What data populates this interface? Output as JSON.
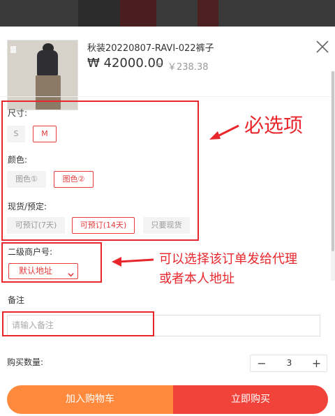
{
  "product": {
    "title": "秋装20220807-RAVI-022裤子",
    "price": "₩ 42000.00",
    "approx_symbol": "≈",
    "price_rmb": "￥238.38"
  },
  "icons": {
    "close": "close-icon",
    "caret": "chevron-down-icon",
    "arrow": "arrow-icon"
  },
  "size": {
    "label": "尺寸:",
    "options": [
      {
        "label": "S",
        "selected": false
      },
      {
        "label": "M",
        "selected": true
      }
    ]
  },
  "color": {
    "label": "颜色:",
    "options": [
      {
        "label": "图色①",
        "selected": false
      },
      {
        "label": "图色②",
        "selected": true
      }
    ]
  },
  "stock": {
    "label": "现货/预定:",
    "options": [
      {
        "label": "可预订(7天)",
        "selected": false
      },
      {
        "label": "可预订(14天)",
        "selected": true
      },
      {
        "label": "只要现货",
        "selected": false
      }
    ]
  },
  "merchant": {
    "label": "二级商户号:",
    "selected": "默认地址"
  },
  "note": {
    "label": "备注",
    "placeholder": "请输入备注"
  },
  "quantity": {
    "label": "购买数量:",
    "minus": "−",
    "value": "3",
    "plus": "+"
  },
  "actions": {
    "add_to_cart": "加入购物车",
    "buy_now": "立即购买"
  },
  "annotations": {
    "required": "必选项",
    "merchant_hint_line1": "可以选择该订单发给代理",
    "merchant_hint_line2": "或者本人地址"
  },
  "colors": {
    "accent_red": "#e63c3c",
    "annotation_red": "#e8262c",
    "cart_orange": "#ff8a3d",
    "buy_red": "#f2433b"
  }
}
